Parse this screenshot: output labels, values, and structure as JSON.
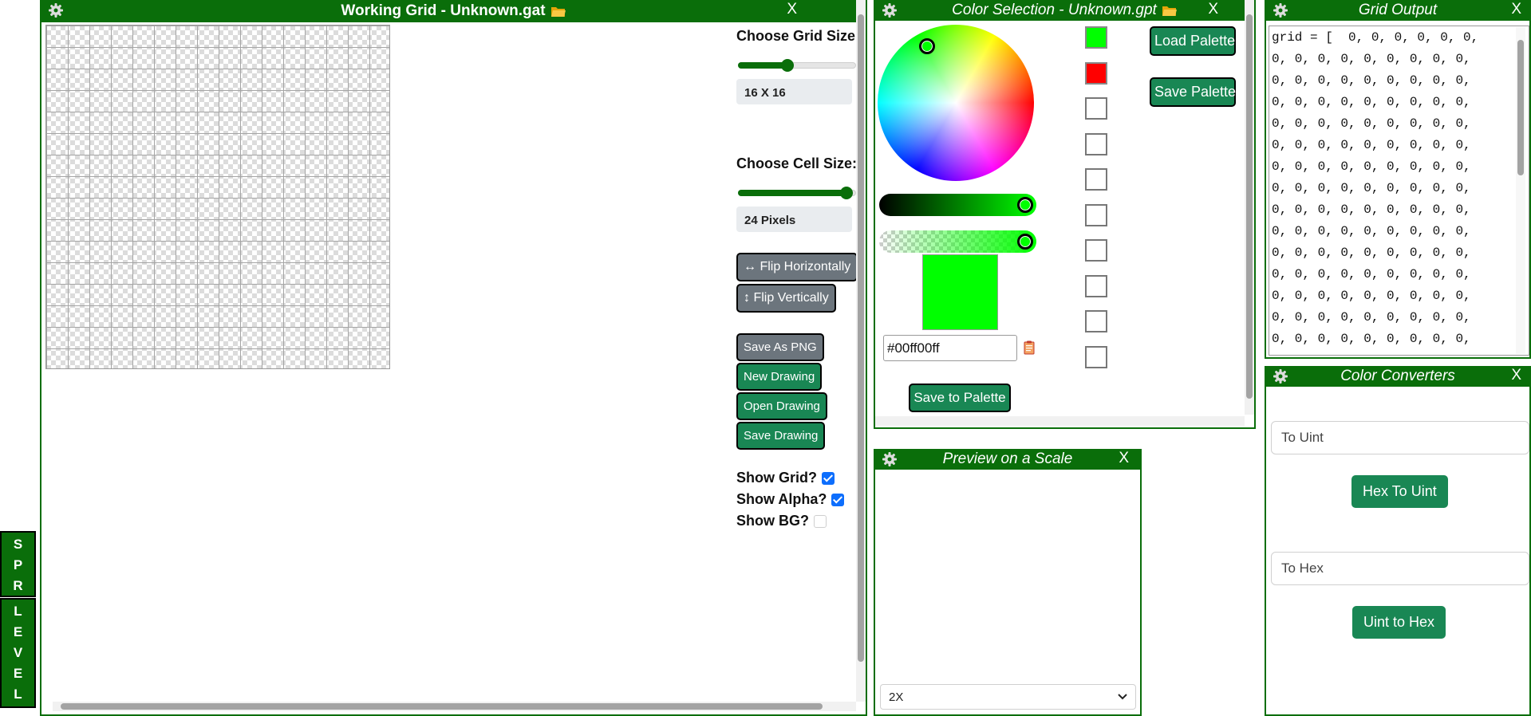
{
  "side_tabs": [
    {
      "letters": [
        "S",
        "P",
        "R"
      ]
    },
    {
      "letters": [
        "L",
        "E",
        "V",
        "E",
        "L"
      ]
    }
  ],
  "working_grid": {
    "title": "Working Grid - Unknown.gat",
    "close_label": "X",
    "grid_size_label": "Choose Grid Size:",
    "grid_size_value": "16 X 16",
    "grid_size_fraction": 0.43,
    "cell_size_label": "Choose Cell Size:",
    "cell_size_value": "24 Pixels",
    "cell_size_fraction": 1.0,
    "flip_h_label": "↔ Flip Horizontally",
    "flip_v_label": "↕ Flip Vertically",
    "save_png_label": "Save As PNG",
    "new_drawing_label": "New Drawing",
    "open_drawing_label": "Open Drawing",
    "save_drawing_label": "Save Drawing",
    "show_grid_label": "Show Grid?",
    "show_grid_checked": true,
    "show_alpha_label": "Show Alpha?",
    "show_alpha_checked": true,
    "show_bg_label": "Show BG?",
    "show_bg_checked": false
  },
  "color_selection": {
    "title": "Color Selection - Unknown.gpt",
    "close_label": "X",
    "hex_value": "#00ff00ff",
    "save_to_palette_label": "Save to Palette",
    "load_palette_label": "Load Palette",
    "save_palette_label": "Save Palette",
    "palette_colors": [
      "#00ff00",
      "#ff0000",
      "",
      "",
      "",
      "",
      "",
      "",
      "",
      ""
    ],
    "current_color": "#00ff00"
  },
  "preview": {
    "title": "Preview on a Scale",
    "close_label": "X",
    "scale_selected": "2X"
  },
  "grid_output": {
    "title": "Grid Output",
    "close_label": "X",
    "code_lines": [
      "grid = [  0, 0, 0, 0, 0, 0,",
      "0, 0, 0, 0, 0, 0, 0, 0, 0,",
      "0, 0, 0, 0, 0, 0, 0, 0, 0,",
      "0, 0, 0, 0, 0, 0, 0, 0, 0,",
      "0, 0, 0, 0, 0, 0, 0, 0, 0,",
      "0, 0, 0, 0, 0, 0, 0, 0, 0,",
      "0, 0, 0, 0, 0, 0, 0, 0, 0,",
      "0, 0, 0, 0, 0, 0, 0, 0, 0,",
      "0, 0, 0, 0, 0, 0, 0, 0, 0,",
      "0, 0, 0, 0, 0, 0, 0, 0, 0,",
      "0, 0, 0, 0, 0, 0, 0, 0, 0,",
      "0, 0, 0, 0, 0, 0, 0, 0, 0,",
      "0, 0, 0, 0, 0, 0, 0, 0, 0,",
      "0, 0, 0, 0, 0, 0, 0, 0, 0,",
      "0, 0, 0, 0, 0, 0, 0, 0, 0,"
    ]
  },
  "color_converters": {
    "title": "Color Converters",
    "close_label": "X",
    "to_uint_placeholder": "To Uint",
    "hex_to_uint_label": "Hex To Uint",
    "to_hex_placeholder": "To Hex",
    "uint_to_hex_label": "Uint to Hex"
  },
  "colors": {
    "titlebar": "#0a6e0a",
    "button_green": "#198754",
    "button_gray": "#6c757d",
    "checkbox_blue": "#0d6efd"
  }
}
